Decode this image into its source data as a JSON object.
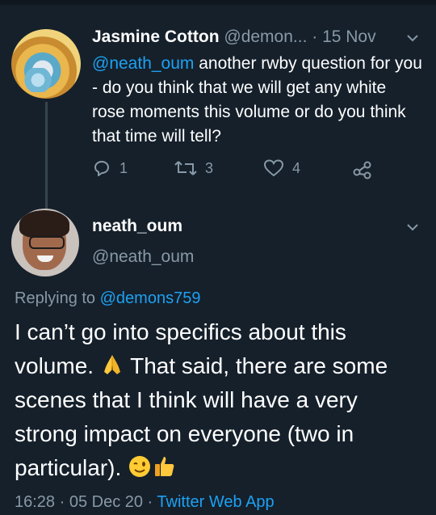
{
  "tweet1": {
    "name": "Jasmine Cotton",
    "handle": "@demon...",
    "date": "· 15 Nov",
    "mention": "@neath_oum",
    "text": " another rwby question for you - do you think that we will get any white rose moments this volume or do you think that time will tell?",
    "replies": "1",
    "retweets": "3",
    "likes": "4"
  },
  "tweet2": {
    "name": "neath_oum",
    "handle": "@neath_oum",
    "replying_prefix": "Replying to ",
    "replying_to": "@demons759",
    "text_part1": "I can’t go into specifics about this volume. ",
    "text_part2": " That said, there are some scenes that I think will have a very strong impact on everyone (two in particular). ",
    "time": "16:28 · 05 Dec 20 · ",
    "source": "Twitter Web App"
  },
  "icons": [
    "chevron-down-icon",
    "reply-icon",
    "retweet-icon",
    "like-icon",
    "share-icon",
    "folded-hands-emoji",
    "winking-face-emoji",
    "thumbs-up-emoji"
  ],
  "colors": {
    "background": "#15202b",
    "accent": "#1da1f2",
    "muted": "#8899a6"
  }
}
